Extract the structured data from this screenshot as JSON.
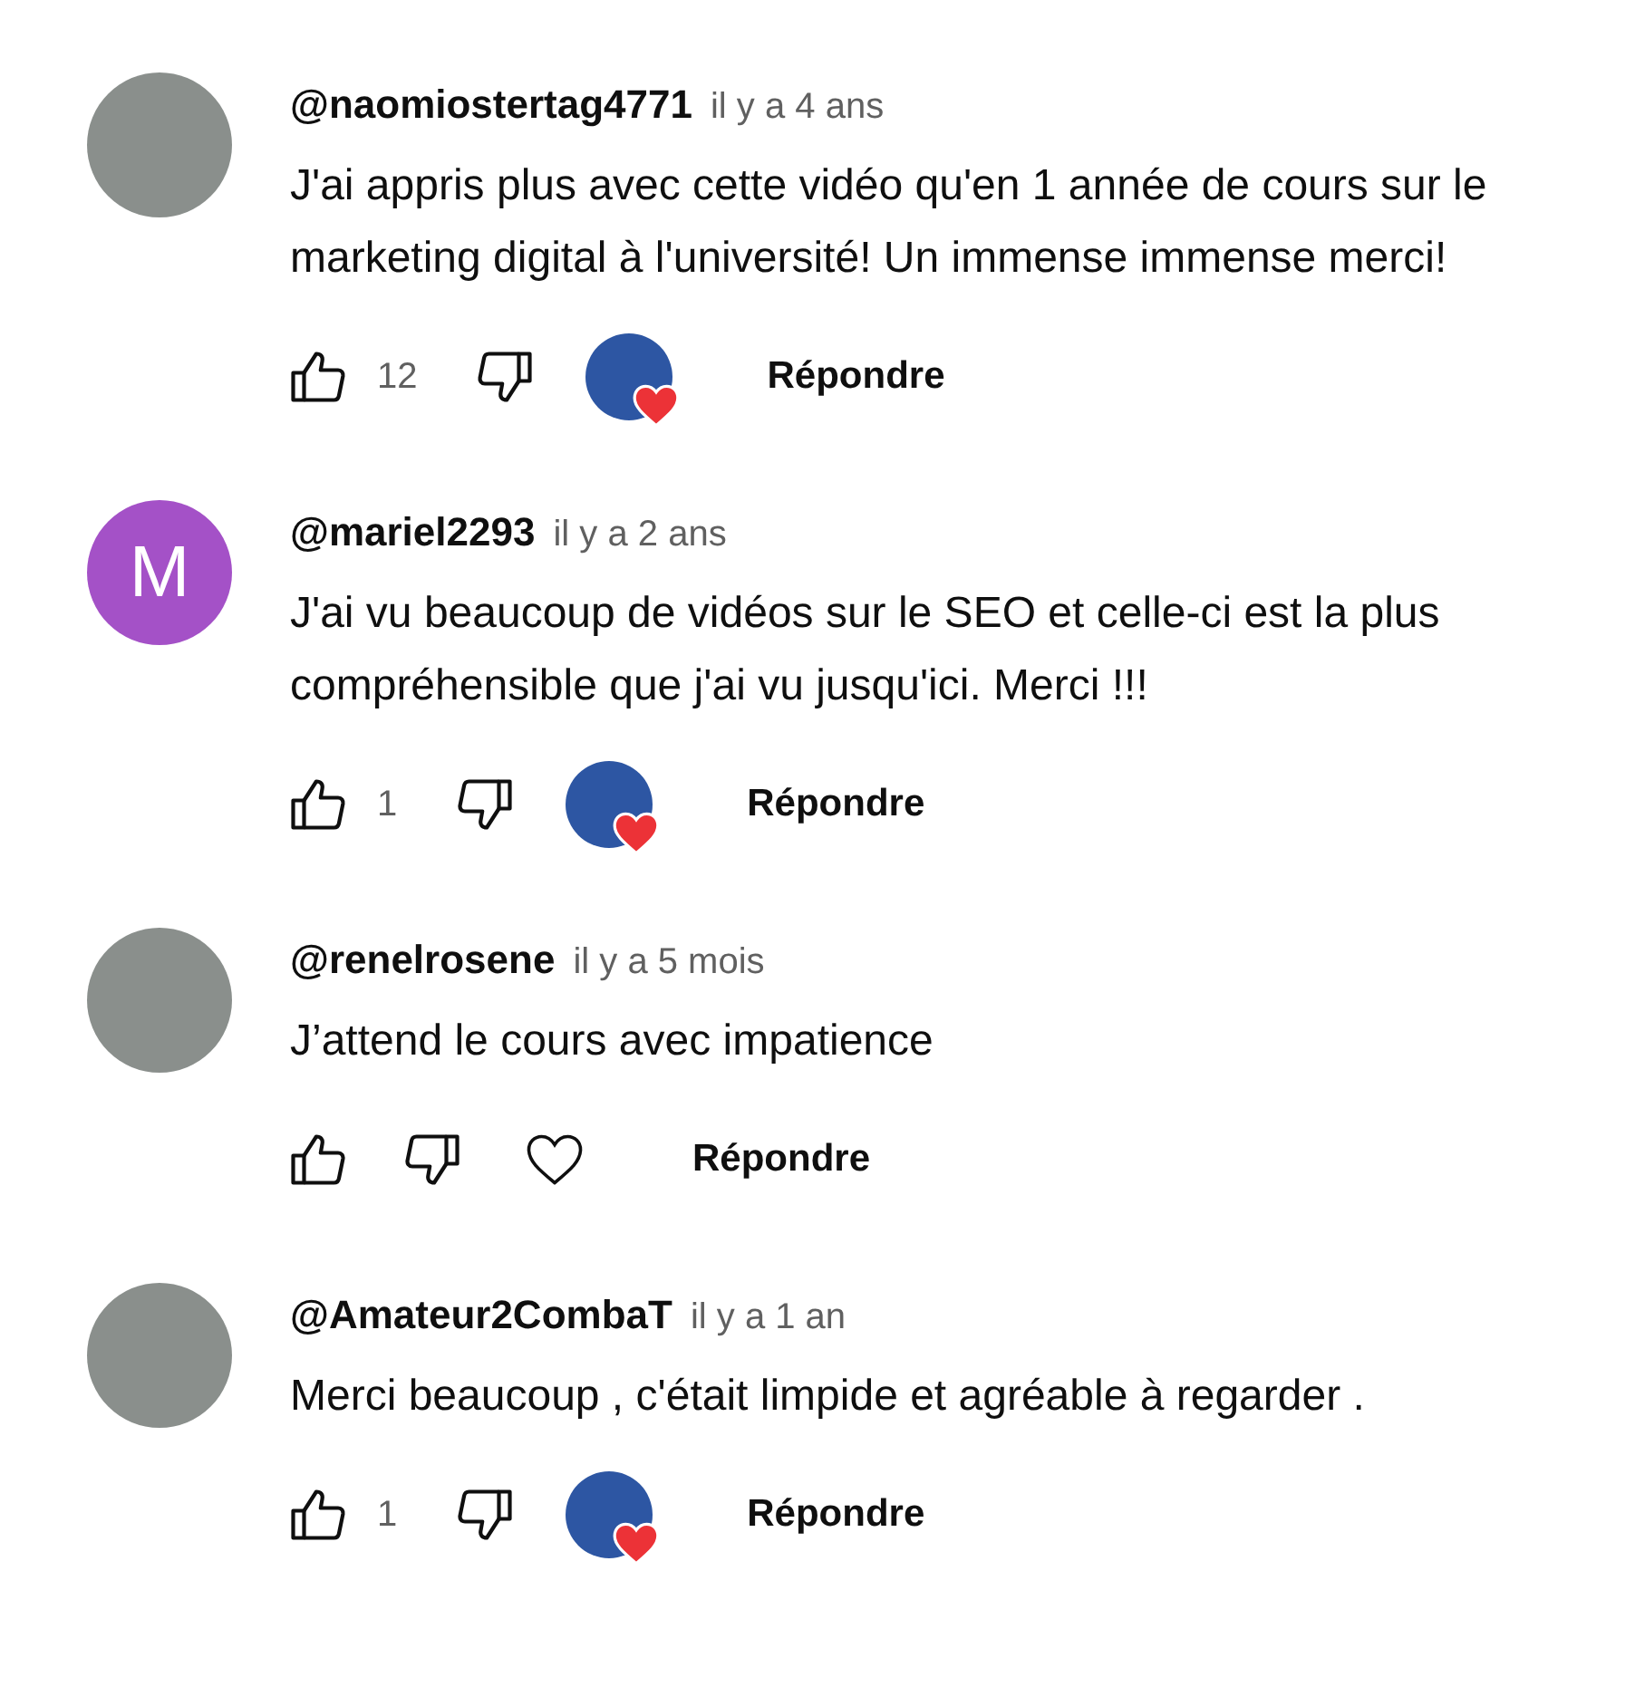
{
  "comments": [
    {
      "author": "@naomiostertag4771",
      "time": "il y a 4 ans",
      "text": "J'ai appris plus avec cette vidéo qu'en 1 année de cours sur le marketing digital à l'université! Un immense immense merci!",
      "avatar": {
        "kind": "photo"
      },
      "likes": "12",
      "creator_heart": true,
      "reply": "Répondre"
    },
    {
      "author": "@mariel2293",
      "time": "il y a 2 ans",
      "text": "J'ai vu beaucoup de vidéos sur le SEO et celle-ci est la plus compréhensible que j'ai vu jusqu'ici. Merci !!!",
      "avatar": {
        "kind": "letter",
        "letter": "M",
        "color": "#a451c7"
      },
      "likes": "1",
      "creator_heart": true,
      "reply": "Répondre"
    },
    {
      "author": "@renelrosene",
      "time": "il y a 5 mois",
      "text": "J’attend le cours avec impatience",
      "avatar": {
        "kind": "photo"
      },
      "creator_heart": false,
      "reply": "Répondre"
    },
    {
      "author": "@Amateur2CombaT",
      "time": "il y a 1 an",
      "text": "Merci beaucoup , c'était limpide et agréable à regarder .",
      "avatar": {
        "kind": "photo"
      },
      "likes": "1",
      "creator_heart": true,
      "reply": "Répondre"
    }
  ]
}
